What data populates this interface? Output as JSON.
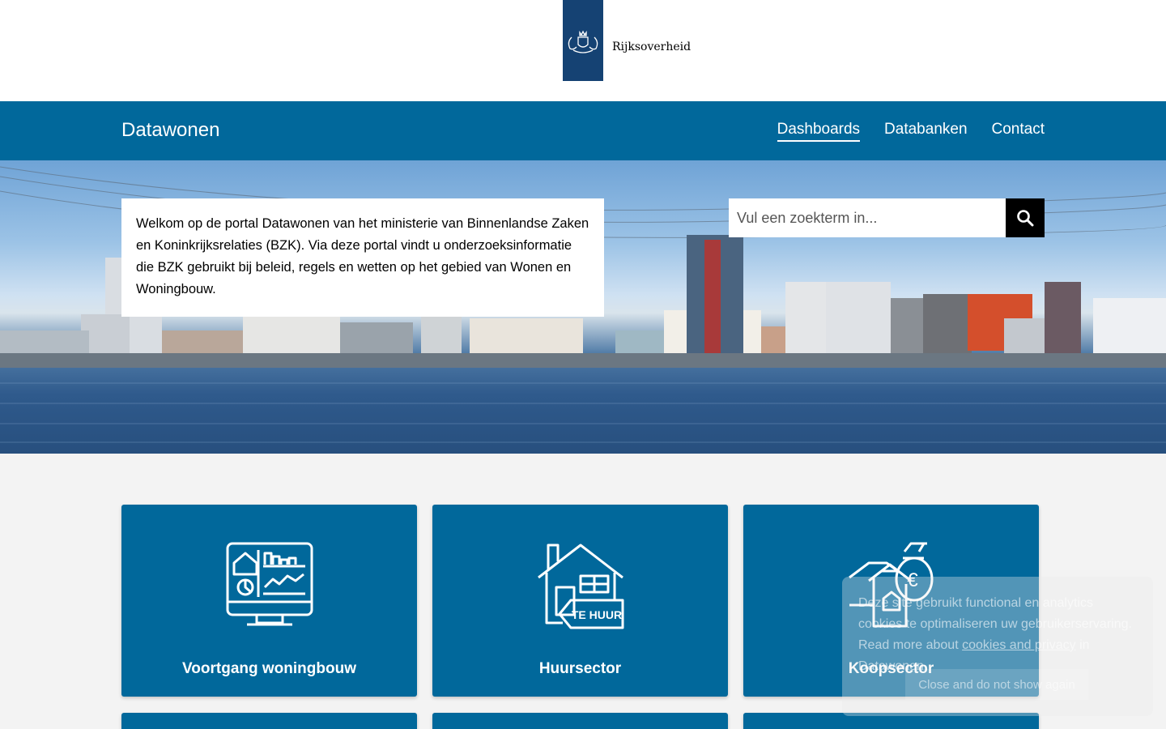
{
  "header": {
    "logo_text": "Rijksoverheid",
    "logo_icon": "coat-of-arms-icon"
  },
  "navbar": {
    "site_title": "Datawonen",
    "links": [
      {
        "label": "Dashboards",
        "active": true
      },
      {
        "label": "Databanken",
        "active": false
      },
      {
        "label": "Contact",
        "active": false
      }
    ]
  },
  "hero": {
    "intro_text": "Welkom op de portal Datawonen van het ministerie van Binnenlandse Zaken en Koninkrijksrelaties (BZK). Via deze portal vindt u onderzoeksinformatie die BZK gebruikt bij beleid, regels en wetten op het gebied van Wonen en Woningbouw.",
    "search_placeholder": "Vul een zoekterm in...",
    "search_icon": "search-icon"
  },
  "cards": [
    {
      "label": "Voortgang woningbouw",
      "icon": "dashboard-monitor-icon"
    },
    {
      "label": "Huursector",
      "icon": "house-for-rent-icon",
      "icon_text": "TE HUUR"
    },
    {
      "label": "Koopsector",
      "icon": "house-money-bag-icon",
      "icon_text": "€"
    }
  ],
  "cookie": {
    "text_before": "Deze site gebruikt functional en analytics cookies te optimaliseren uw gebruikerservaring. Read more about",
    "link_text": "cookies and privacy",
    "text_after": "in Datawonen",
    "button_label": "Close and do not show again"
  },
  "colors": {
    "brand_blue": "#01689b",
    "logo_blue": "#154273",
    "search_button": "#000000"
  }
}
